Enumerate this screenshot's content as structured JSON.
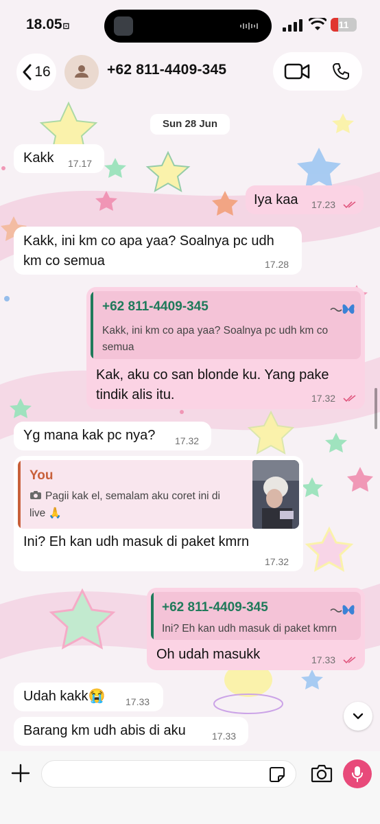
{
  "status_bar": {
    "time": "18.05",
    "time_suffix": "⚀",
    "battery": "11"
  },
  "header": {
    "back_count": "16",
    "contact": "+62 811-4409-345"
  },
  "chat": {
    "date": "Sun 28 Jun",
    "messages": [
      {
        "text": "Kakk",
        "time": "17.17"
      },
      {
        "text": "Iya kaa",
        "time": "17.23"
      },
      {
        "text_line1": "Kakk, ini km co apa yaa? Soalnya pc udh",
        "text_line2": "km co semua",
        "time": "17.28"
      },
      {
        "quote_name": "+62 811-4409-345",
        "quote_line1": "Kakk, ini km co apa yaa? Soalnya pc udh km co",
        "quote_line2": "semua",
        "text_line1": "Kak, aku co san blonde ku. Yang pake",
        "text_line2": "tindik alis itu.",
        "time": "17.32"
      },
      {
        "text": "Yg mana kak pc nya?",
        "time": "17.32"
      },
      {
        "quote_name": "You",
        "quote_line1": "Pagii kak el, semalam aku coret ini di",
        "quote_line2": "live 🙏",
        "text": "Ini? Eh kan udh masuk di paket kmrn",
        "time": "17.32"
      },
      {
        "quote_name": "+62 811-4409-345",
        "quote_line1": "Ini? Eh kan udh masuk di paket kmrn",
        "text": "Oh udah masukk",
        "time": "17.33"
      },
      {
        "text": "Udah kakk😭",
        "time": "17.33"
      },
      {
        "text": "Barang km udh abis di aku",
        "time": "17.33"
      }
    ]
  },
  "colors": {
    "incoming_bubble": "#ffffff",
    "outgoing_bubble": "#fbd3e4",
    "quote_contact": "#1f7a5a",
    "quote_you": "#c8603a",
    "read_ticks": "#e0567e",
    "mic_button": "#e84a7a"
  },
  "icons": [
    "chevron-left-icon",
    "person-icon",
    "video-icon",
    "phone-icon",
    "plus-icon",
    "sticker-icon",
    "camera-icon",
    "mic-icon",
    "chevron-down-icon",
    "butterfly-icon",
    "camera-small-icon"
  ]
}
